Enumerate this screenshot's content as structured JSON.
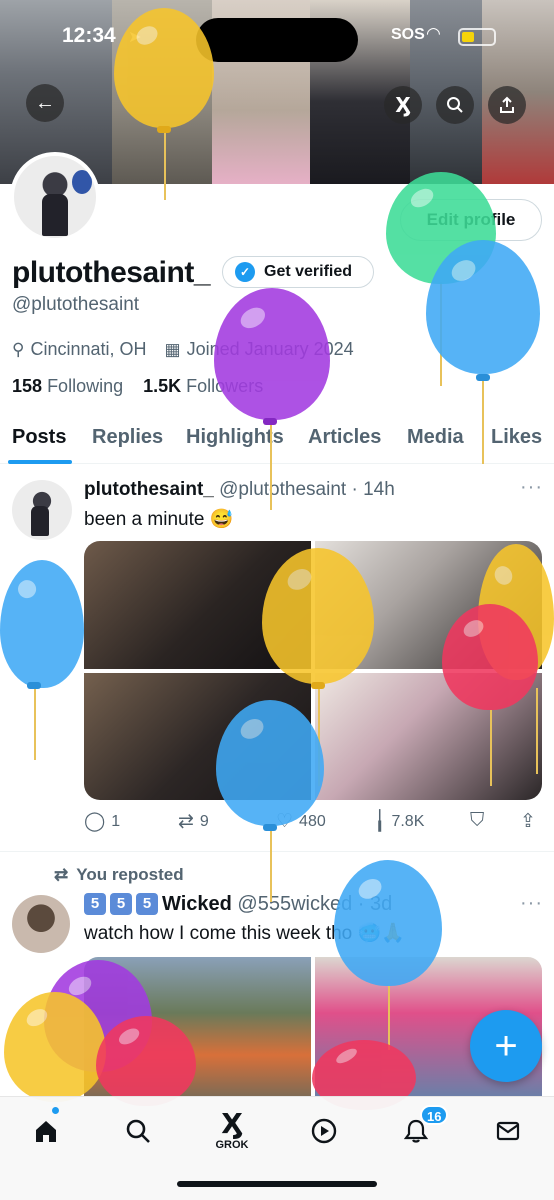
{
  "status_bar": {
    "time": "12:34",
    "sos": "SOS"
  },
  "header": {
    "edit_profile_label": "Edit profile"
  },
  "profile": {
    "display_name": "plutothesaint_",
    "get_verified_label": "Get verified",
    "handle": "@plutothesaint",
    "location": "Cincinnati, OH",
    "joined": "Joined January 2024",
    "following_count": "158",
    "following_label": "Following",
    "followers_count": "1.5K",
    "followers_label": "Followers"
  },
  "tabs": [
    {
      "label": "Posts",
      "active": true
    },
    {
      "label": "Replies"
    },
    {
      "label": "Highlights"
    },
    {
      "label": "Articles"
    },
    {
      "label": "Media"
    },
    {
      "label": "Likes"
    }
  ],
  "posts": [
    {
      "author": "plutothesaint_",
      "handle": "@plutothesaint",
      "time": "14h",
      "text": "been a minute 😅",
      "replies": "1",
      "reposts": "9",
      "likes": "480",
      "views": "7.8K"
    },
    {
      "repost_label": "You reposted",
      "author_numbers": [
        "5",
        "5",
        "5"
      ],
      "author": "Wicked",
      "handle": "@555wicked",
      "time": "3d",
      "text": "watch how I come this week tho 🥶🙏"
    }
  ],
  "bottom_nav": {
    "grok_label": "GROK",
    "notifications_count": "16"
  },
  "colors": {
    "accent": "#1d9bf0",
    "text_primary": "#0f1419",
    "text_secondary": "#536471"
  },
  "icons": {
    "back": "arrow-left",
    "grok": "grok-logo",
    "search": "magnifier",
    "share": "upload-arrow",
    "location": "map-pin",
    "calendar": "calendar",
    "reply": "speech-bubble",
    "repost": "repost-arrows",
    "like": "heart",
    "views": "bar-chart",
    "bookmark": "bookmark",
    "compose": "plus",
    "home": "house",
    "notifications": "bell",
    "messages": "envelope"
  }
}
